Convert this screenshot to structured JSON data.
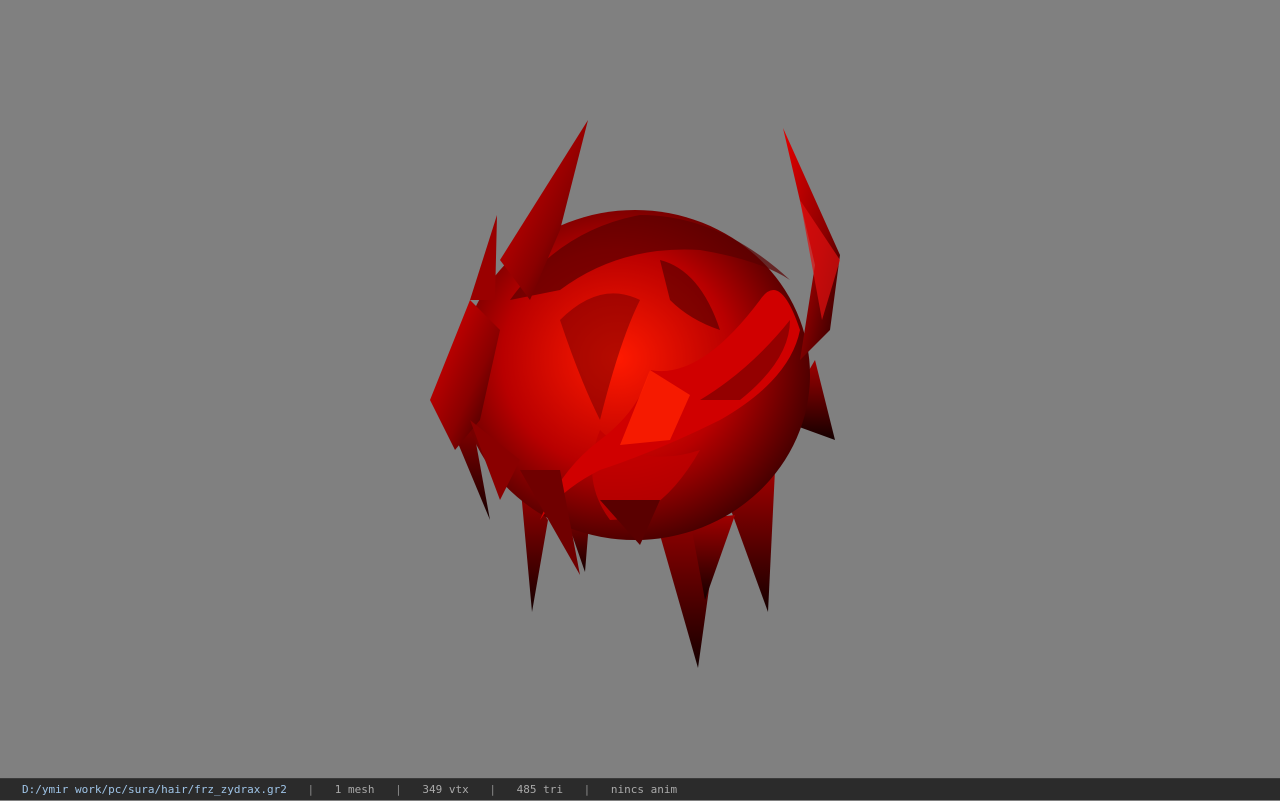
{
  "viewport": {
    "model_icon": "red-hair-mesh",
    "background_color": "#808080",
    "model_color": "#cc0000"
  },
  "statusbar": {
    "file_path": "D:/ymir work/pc/sura/hair/frz_zydrax.gr2",
    "separator": "|",
    "mesh_count": "1 mesh",
    "vertex_count": "349 vtx",
    "triangle_count": "485 tri",
    "anim_status": "nincs anim"
  }
}
